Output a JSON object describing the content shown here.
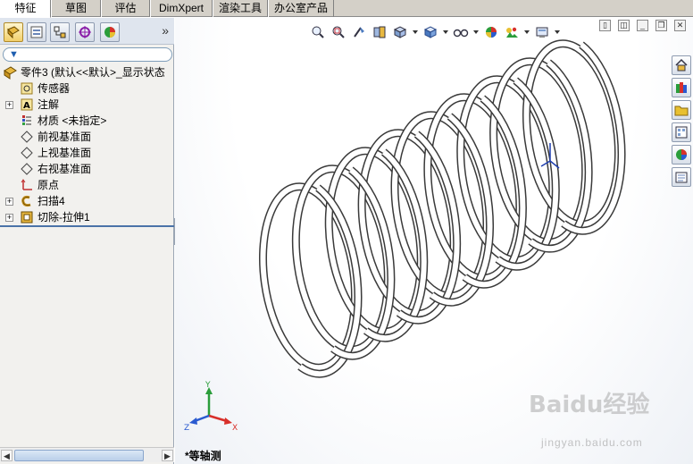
{
  "tabs": [
    {
      "label": "特征",
      "active": true
    },
    {
      "label": "草图",
      "active": false
    },
    {
      "label": "评估",
      "active": false
    },
    {
      "label": "DimXpert",
      "active": false
    },
    {
      "label": "渲染工具",
      "active": false
    },
    {
      "label": "办公室产品",
      "active": false
    }
  ],
  "panel": {
    "more_glyph": "»",
    "tabs": [
      "featuremanager-icon",
      "propertymanager-icon",
      "configurationmanager-icon",
      "dimxpert-icon",
      "display-manager-icon"
    ]
  },
  "tree": {
    "root": "零件3  (默认<<默认>_显示状态",
    "items": [
      {
        "label": "传感器",
        "icon": "sensor-icon",
        "expandable": false
      },
      {
        "label": "注解",
        "icon": "annotation-icon",
        "expandable": true
      },
      {
        "label": "材质 <未指定>",
        "icon": "material-icon",
        "expandable": false
      },
      {
        "label": "前视基准面",
        "icon": "plane-icon",
        "expandable": false
      },
      {
        "label": "上视基准面",
        "icon": "plane-icon",
        "expandable": false
      },
      {
        "label": "右视基准面",
        "icon": "plane-icon",
        "expandable": false
      },
      {
        "label": "原点",
        "icon": "origin-icon",
        "expandable": false
      },
      {
        "label": "扫描4",
        "icon": "sweep-icon",
        "expandable": true
      },
      {
        "label": "切除-拉伸1",
        "icon": "cut-extrude-icon",
        "expandable": true
      }
    ]
  },
  "viewport": {
    "view_name": "*等轴测",
    "triad": {
      "x": "X",
      "y": "Y",
      "z": "Z"
    },
    "watermark": "Baidu经验",
    "watermark_sub": "jingyan.baidu.com"
  },
  "colors": {
    "accent": "#4b73a8",
    "panel_bg": "#f2f1ee",
    "spring": "#ffffff",
    "spring_edge": "#3a3a3a"
  }
}
